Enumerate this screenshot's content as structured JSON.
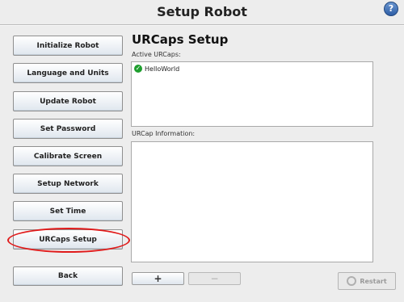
{
  "window": {
    "title": "Setup Robot",
    "help_icon": "?"
  },
  "sidebar": {
    "items": [
      {
        "label": "Initialize Robot"
      },
      {
        "label": "Language and Units"
      },
      {
        "label": "Update Robot"
      },
      {
        "label": "Set Password"
      },
      {
        "label": "Calibrate Screen"
      },
      {
        "label": "Setup Network"
      },
      {
        "label": "Set Time"
      },
      {
        "label": "URCaps Setup"
      }
    ],
    "back_label": "Back"
  },
  "main": {
    "heading": "URCaps Setup",
    "active_label": "Active URCaps:",
    "active_list": [
      {
        "name": "HelloWorld",
        "status_icon": "check-circle-icon"
      }
    ],
    "info_label": "URCap Information:",
    "add_symbol": "+",
    "remove_symbol": "−",
    "restart_label": "Restart"
  },
  "colors": {
    "highlight": "#e01b1b",
    "check": "#1e9e2e"
  }
}
